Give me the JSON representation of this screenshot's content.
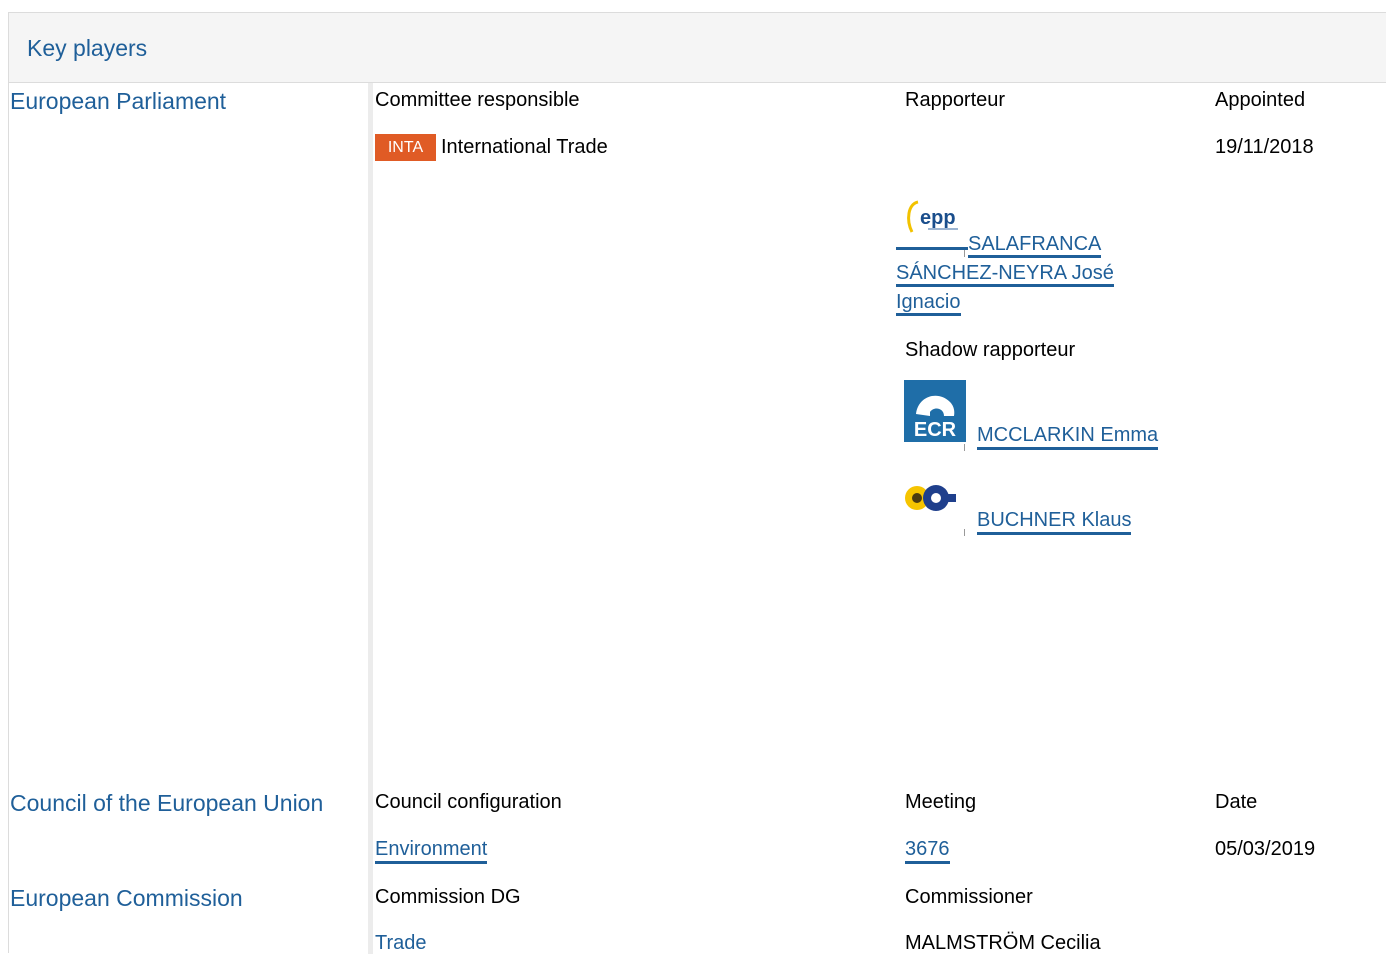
{
  "panel": {
    "title": "Key players"
  },
  "parliament": {
    "name": "European Parliament",
    "committee_header": "Committee responsible",
    "rapporteur_header": "Rapporteur",
    "appointed_header": "Appointed",
    "committee_code": "INTA",
    "committee_name": "International Trade",
    "appointed_date": "19/11/2018",
    "rapporteur": {
      "name": "SALAFRANCA SÁNCHEZ-NEYRA José Ignacio",
      "group_logo": "epp-logo"
    },
    "shadow_header": "Shadow rapporteur",
    "shadows": [
      {
        "name": "MCCLARKIN Emma",
        "group_logo": "ecr-logo"
      },
      {
        "name": "BUCHNER Klaus",
        "group_logo": "efa-logo"
      }
    ]
  },
  "council": {
    "name": "Council of the European Union",
    "config_header": "Council configuration",
    "meeting_header": "Meeting",
    "date_header": "Date",
    "configuration": "Environment",
    "meeting": "3676",
    "date": "05/03/2019"
  },
  "commission": {
    "name": "European Commission",
    "dg_header": "Commission DG",
    "commissioner_header": "Commissioner",
    "dg": "Trade",
    "commissioner": "MALMSTRÖM Cecilia"
  },
  "colors": {
    "link": "#1f5f99",
    "badge": "#e05b25",
    "header_bg": "#f5f5f5"
  }
}
